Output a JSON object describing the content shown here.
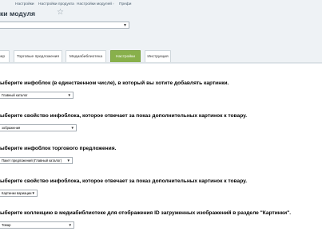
{
  "breadcrumb": {
    "items": [
      "Настройки",
      "Настройки продукта",
      "Настройки модулей",
      "Префи"
    ]
  },
  "page": {
    "title": "ки модуля",
    "site_select_value": ""
  },
  "tabs": [
    {
      "label": "нер"
    },
    {
      "label": "Торговые предложения"
    },
    {
      "label": "Медиабиблиотека"
    },
    {
      "label": "Настройки"
    },
    {
      "label": "Инструкция"
    }
  ],
  "settings": [
    {
      "label": "ыберите инфоблок (в единственном числе), в который вы хотите добавлять картинки.",
      "value": "Главный каталог"
    },
    {
      "label": "ыберите свойство инфоблока, которое отвечает за показ дополнительных картинок к товару.",
      "value": "зображения"
    },
    {
      "label": "ыберите инфоблок торгового предложения.",
      "value": "Пакет предложений (Главный каталог)"
    },
    {
      "label": "ыберите свойство инфоблока, которое отвечает за показ дополнительных картинок к товару.",
      "value": "Картинки вариации"
    },
    {
      "label": "ыберите коллекцию в медиабиблиотеке для отображения ID загруженных изображений в разделе \"Картинки\".",
      "value": "Товар"
    }
  ],
  "colors": {
    "header_bg": "#eef2f5",
    "active_tab_bg": "#88b04b"
  }
}
